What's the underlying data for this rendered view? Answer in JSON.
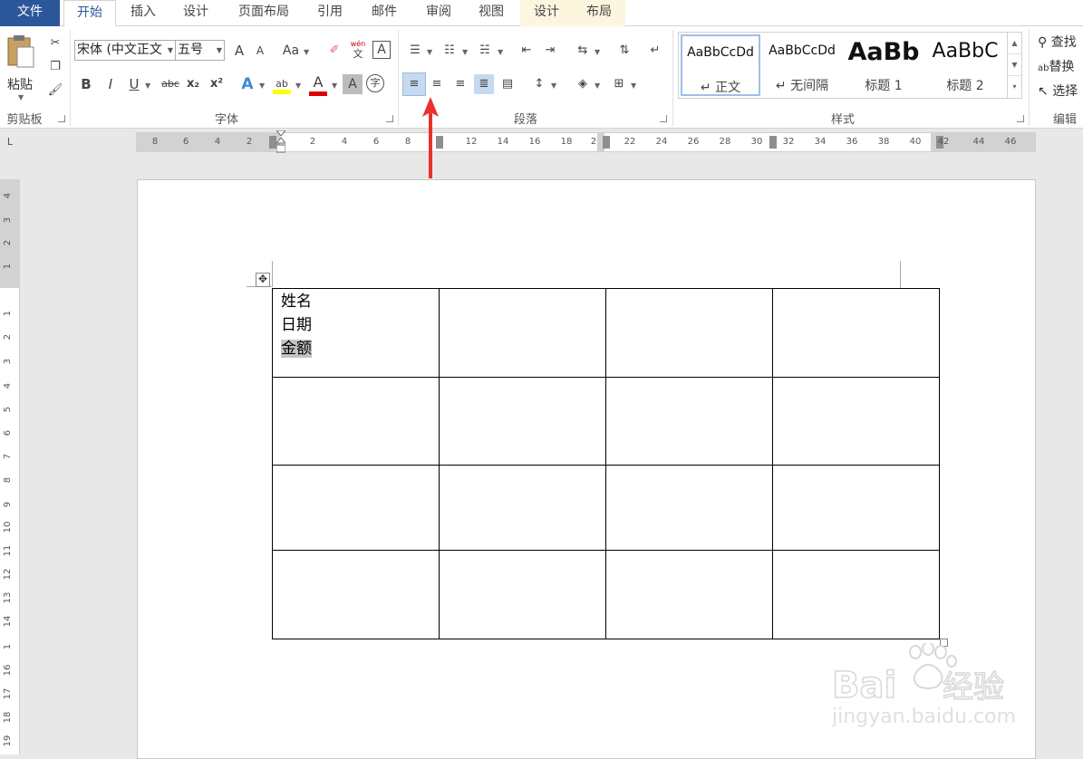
{
  "tabs": [
    "文件",
    "开始",
    "插入",
    "设计",
    "页面布局",
    "引用",
    "邮件",
    "审阅",
    "视图",
    "设计",
    "布局"
  ],
  "ribbon": {
    "paste_label": "粘贴",
    "font_name": "宋体 (中文正文",
    "font_size": "五号",
    "group_labels": {
      "clipboard": "剪贴板",
      "font": "字体",
      "paragraph": "段落",
      "styles": "样式",
      "editing": "编辑"
    },
    "styles": [
      {
        "preview": "AaBbCcDd",
        "name": "↵ 正文"
      },
      {
        "preview": "AaBbCcDd",
        "name": "↵ 无间隔"
      },
      {
        "preview": "AaBb",
        "name": "标题 1"
      },
      {
        "preview": "AaBbC",
        "name": "标题 2"
      }
    ],
    "editing": [
      "查找",
      "替换",
      "选择"
    ],
    "font_buttons": {
      "bold": "B",
      "italic": "I",
      "underline": "U",
      "strike": "abc",
      "sub": "x₂",
      "sup": "x²",
      "aa": "Aa",
      "grow": "A",
      "shrink": "A",
      "phonetic_top": "wén",
      "phonetic_bottom": "文",
      "border_a": "A",
      "color_a": "A",
      "shade_a": "A",
      "circled": "字"
    },
    "selected_align": "align-left"
  },
  "rulers": {
    "horizontal": [
      "8",
      "6",
      "4",
      "2",
      "2",
      "4",
      "6",
      "8",
      "12",
      "14",
      "16",
      "18",
      "2",
      "22",
      "24",
      "26",
      "28",
      "30",
      "32",
      "34",
      "36",
      "38",
      "40",
      "42",
      "44",
      "46"
    ],
    "vertical": [
      "4",
      "3",
      "2",
      "1",
      "1",
      "2",
      "3",
      "4",
      "5",
      "6",
      "7",
      "8",
      "9",
      "10",
      "11",
      "12",
      "13",
      "14",
      "1",
      "16",
      "17",
      "18",
      "19"
    ],
    "corner": "L"
  },
  "document": {
    "table": {
      "rows": 4,
      "cols": 4,
      "cell_0_0": [
        "姓名",
        "日期",
        "金额"
      ],
      "selected_text": "金额"
    }
  },
  "colors": {
    "file_tab": "#2b579a",
    "active_tab_text": "#2b579a",
    "highlight_yellow": "#ffff00",
    "font_red": "#e00000",
    "arrow_red": "#e8322d",
    "selection_grey": "#c4c4c4"
  },
  "watermark": {
    "logo": "Bai du 经验",
    "url": "jingyan.baidu.com"
  }
}
